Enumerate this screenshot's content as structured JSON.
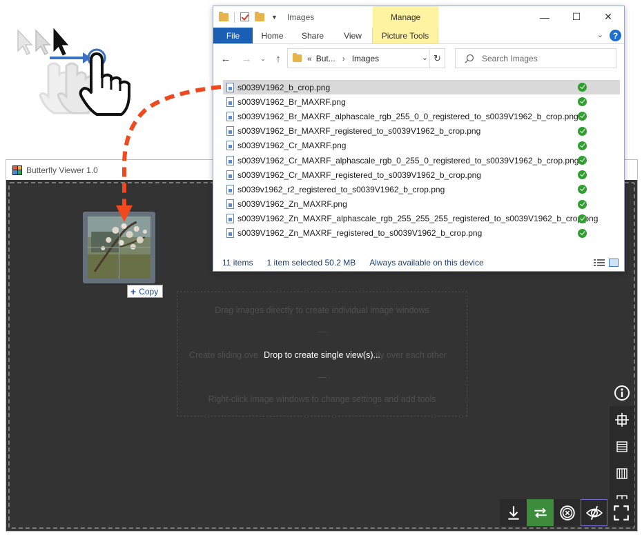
{
  "illustration": {
    "icon": "drag-hand-gesture-icon"
  },
  "butterfly": {
    "title": "Butterfly Viewer 1.0",
    "hints": [
      "Drag images directly to create individual image windows",
      "—",
      "Create sliding ove",
      "tly over each other",
      "—",
      "Right-click image windows to change settings and add tools"
    ],
    "drop_label": "Drop to create single view(s)...",
    "copy_badge": "Copy",
    "side_toolbar": [
      "info-icon",
      "crosshair-icon",
      "stack-horizontal-icon",
      "stack-vertical-icon",
      "grid-icon"
    ],
    "bottom_toolbar": [
      "save-icon",
      "sync-icon",
      "close-all-icon",
      "hide-interface-icon",
      "fullscreen-icon"
    ],
    "accent": "#3c8c3c"
  },
  "explorer": {
    "title": "Images",
    "manage_tab": "Manage",
    "ribbon_tabs": {
      "file": "File",
      "home": "Home",
      "share": "Share",
      "view": "View",
      "picture_tools": "Picture Tools"
    },
    "address": {
      "chev": "«",
      "parent": "But...",
      "sep": "›",
      "current": "Images"
    },
    "search_placeholder": "Search Images",
    "files": [
      "s0039V1962_b_crop.png",
      "s0039V1962_Br_MAXRF.png",
      "s0039V1962_Br_MAXRF_alphascale_rgb_255_0_0_registered_to_s0039V1962_b_crop.png",
      "s0039V1962_Br_MAXRF_registered_to_s0039V1962_b_crop.png",
      "s0039V1962_Cr_MAXRF.png",
      "s0039V1962_Cr_MAXRF_alphascale_rgb_0_255_0_registered_to_s0039V1962_b_crop.png",
      "s0039V1962_Cr_MAXRF_registered_to_s0039V1962_b_crop.png",
      "s0039v1962_r2_registered_to_s0039V1962_b_crop.png",
      "s0039V1962_Zn_MAXRF.png",
      "s0039V1962_Zn_MAXRF_alphascale_rgb_255_255_255_registered_to_s0039V1962_b_crop.png",
      "s0039V1962_Zn_MAXRF_registered_to_s0039V1962_b_crop.png"
    ],
    "status": {
      "count": "11 items",
      "selected": "1 item selected  50.2 MB",
      "availability": "Always available on this device"
    },
    "file_tab_color": "#1a5fb4",
    "manage_color": "#fdf3a0",
    "status_color": "#2fa02f"
  }
}
